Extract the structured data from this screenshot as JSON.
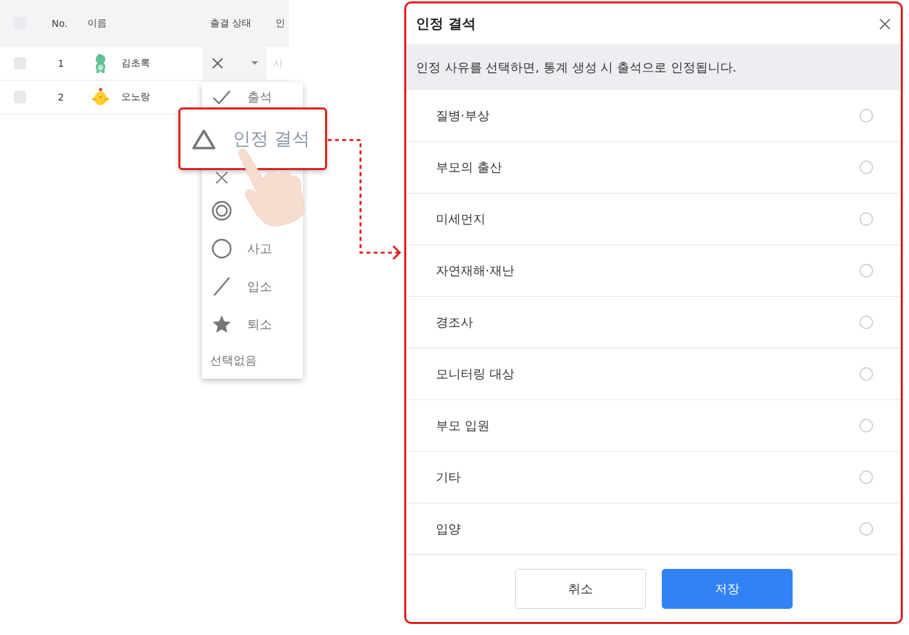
{
  "table": {
    "select_all": {
      "checked": false
    },
    "columns": [
      "No.",
      "이름",
      "출결 상태",
      "인"
    ],
    "rows": [
      {
        "checked": false,
        "no": "1",
        "name": "김초록",
        "avatar": {
          "kind": "dinosaur"
        },
        "status": {
          "kind": "absent"
        },
        "reason_placeholder": "사"
      },
      {
        "checked": false,
        "no": "2",
        "name": "오노랑",
        "avatar": {
          "kind": "chick"
        }
      }
    ]
  },
  "status_menu": {
    "items": [
      {
        "kind": "check",
        "label": "출석"
      },
      {
        "kind": "cross"
      },
      {
        "kind": "double-circle"
      },
      {
        "kind": "circle",
        "label": "사고"
      },
      {
        "kind": "slash",
        "label": "입소"
      },
      {
        "kind": "star",
        "label": "퇴소"
      },
      {
        "kind": "none",
        "label": "선택없음"
      }
    ]
  },
  "callout": {
    "kind": "triangle",
    "label": "인정 결석"
  },
  "dialog": {
    "title": "인정 결석",
    "notice": "인정 사유를 선택하면, 통계 생성 시 출석으로 인정됩니다.",
    "options": [
      {
        "label": "질병·부상",
        "selected": false
      },
      {
        "label": "부모의 출산",
        "selected": false
      },
      {
        "label": "미세먼지",
        "selected": false
      },
      {
        "label": "자연재해·재난",
        "selected": false
      },
      {
        "label": "경조사",
        "selected": false
      },
      {
        "label": "모니터링 대상",
        "selected": false
      },
      {
        "label": "부모 입원",
        "selected": false
      },
      {
        "label": "기타",
        "selected": false
      },
      {
        "label": "입양",
        "selected": false
      }
    ],
    "buttons": [
      {
        "kind": "secondary",
        "label": "취소"
      },
      {
        "kind": "primary",
        "label": "저장"
      }
    ]
  }
}
